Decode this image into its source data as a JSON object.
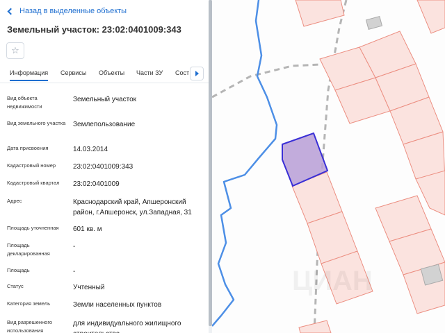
{
  "nav": {
    "back_label": "Назад в выделенные объекты"
  },
  "header": {
    "title": "Земельный участок: 23:02:0401009:343"
  },
  "tabs": [
    {
      "label": "Информация"
    },
    {
      "label": "Сервисы"
    },
    {
      "label": "Объекты"
    },
    {
      "label": "Части ЗУ"
    },
    {
      "label": "Соста"
    }
  ],
  "properties": [
    {
      "label": "Вид объекта недвижимости",
      "value": "Земельный участок"
    },
    {
      "label": "Вид земельного участка",
      "value": "Землепользование"
    },
    {
      "label": "Дата присвоения",
      "value": "14.03.2014"
    },
    {
      "label": "Кадастровый номер",
      "value": "23:02:0401009:343"
    },
    {
      "label": "Кадастровый квартал",
      "value": "23:02:0401009"
    },
    {
      "label": "Адрес",
      "value": "Краснодарский край, Апшеронский район, г.Апшеронск, ул.Западная, 31"
    },
    {
      "label": "Площадь уточненная",
      "value": "601 кв. м"
    },
    {
      "label": "Площадь декларированная",
      "value": "-"
    },
    {
      "label": "Площадь",
      "value": "-"
    },
    {
      "label": "Статус",
      "value": "Учтенный"
    },
    {
      "label": "Категория земель",
      "value": "Земли населенных пунктов"
    },
    {
      "label": "Вид разрешенного использования",
      "value": "для индивидуального жилищного строительства"
    }
  ],
  "map": {
    "watermark": "ЦИАН",
    "colors": {
      "parcel_fill": "#fbe3df",
      "parcel_stroke": "#ec8f82",
      "selected_fill": "#b79ed6",
      "selected_stroke": "#3a2fd6",
      "river": "#4d8fe6",
      "road": "#b5b5b5"
    }
  }
}
